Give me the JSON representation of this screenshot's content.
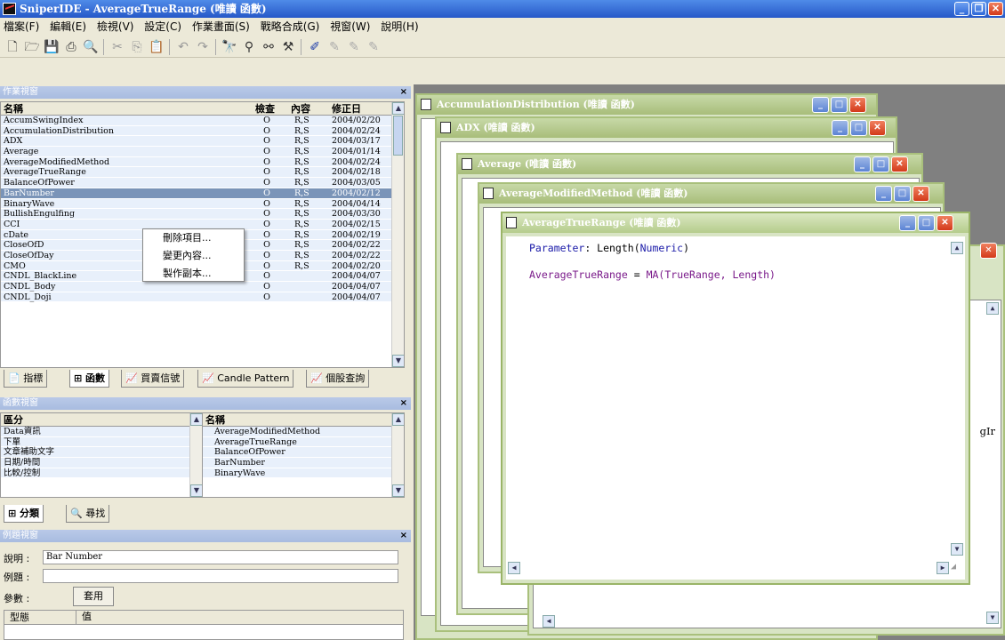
{
  "app": {
    "title": "SniperIDE - AverageTrueRange (唯讀 函數)"
  },
  "menu": [
    "檔案(F)",
    "編輯(E)",
    "檢視(V)",
    "設定(C)",
    "作業畫面(S)",
    "戰略合成(G)",
    "視窗(W)",
    "說明(H)"
  ],
  "work_pane": {
    "title": "作業視窗",
    "columns": [
      "名稱",
      "檢查",
      "內容",
      "修正日"
    ],
    "rows": [
      {
        "name": "AccumSwingIndex",
        "check": "O",
        "content": "R,S",
        "date": "2004/02/20"
      },
      {
        "name": "AccumulationDistribution",
        "check": "O",
        "content": "R,S",
        "date": "2004/02/24"
      },
      {
        "name": "ADX",
        "check": "O",
        "content": "R,S",
        "date": "2004/03/17"
      },
      {
        "name": "Average",
        "check": "O",
        "content": "R,S",
        "date": "2004/01/14"
      },
      {
        "name": "AverageModifiedMethod",
        "check": "O",
        "content": "R,S",
        "date": "2004/02/24"
      },
      {
        "name": "AverageTrueRange",
        "check": "O",
        "content": "R,S",
        "date": "2004/02/18"
      },
      {
        "name": "BalanceOfPower",
        "check": "O",
        "content": "R,S",
        "date": "2004/03/05"
      },
      {
        "name": "BarNumber",
        "check": "O",
        "content": "R,S",
        "date": "2004/02/12"
      },
      {
        "name": "BinaryWave",
        "check": "O",
        "content": "R,S",
        "date": "2004/04/14"
      },
      {
        "name": "BullishEngulfing",
        "check": "O",
        "content": "R,S",
        "date": "2004/03/30"
      },
      {
        "name": "CCI",
        "check": "O",
        "content": "R,S",
        "date": "2004/02/15"
      },
      {
        "name": "cDate",
        "check": "O",
        "content": "R,S",
        "date": "2004/02/19"
      },
      {
        "name": "CloseOfD",
        "check": "O",
        "content": "R,S",
        "date": "2004/02/22"
      },
      {
        "name": "CloseOfDay",
        "check": "O",
        "content": "R,S",
        "date": "2004/02/22"
      },
      {
        "name": "CMO",
        "check": "O",
        "content": "R,S",
        "date": "2004/02/20"
      },
      {
        "name": "CNDL_BlackLine",
        "check": "O",
        "content": "",
        "date": "2004/04/07"
      },
      {
        "name": "CNDL_Body",
        "check": "O",
        "content": "",
        "date": "2004/04/07"
      },
      {
        "name": "CNDL_Doji",
        "check": "O",
        "content": "",
        "date": "2004/04/07"
      }
    ],
    "selected_row": "BarNumber",
    "tabs": [
      "指標",
      "函數",
      "買賣信號",
      "Candle Pattern",
      "個股查詢"
    ],
    "active_tab": "函數"
  },
  "context_menu": [
    "刪除項目...",
    "變更內容...",
    "製作副本..."
  ],
  "func_pane": {
    "title": "函數視窗",
    "left_header": "區分",
    "left_items": [
      "Data資訊",
      "下單",
      "文章補助文字",
      "日期/時間",
      "比較/控制"
    ],
    "right_header": "名稱",
    "right_items": [
      "AverageModifiedMethod",
      "AverageTrueRange",
      "BalanceOfPower",
      "BarNumber",
      "BinaryWave"
    ],
    "tabs": [
      "分類",
      "尋找"
    ]
  },
  "example_pane": {
    "title": "例題視窗",
    "desc_label": "說明 :",
    "desc_value": "Bar Number",
    "example_label": "例題 :",
    "params_label": "參數 :",
    "apply_button": "套用",
    "col_type": "型態",
    "col_value": "值"
  },
  "mdi": {
    "windows": [
      "AccumulationDistribution (唯讀 函數)",
      "ADX (唯讀 函數)",
      "Average (唯讀 函數)",
      "AverageModifiedMethod (唯讀 函數)",
      "AverageTrueRange (唯讀 函數)"
    ],
    "code_lines": [
      {
        "kw": "Parameter",
        "rest": ": Length(",
        "type": "Numeric",
        "end": ")"
      },
      {
        "kw": "AverageTrueRange",
        "rest": " = ",
        "type": "MA",
        "end": "(TrueRange, Length)"
      }
    ],
    "peek_text": "gIr"
  }
}
